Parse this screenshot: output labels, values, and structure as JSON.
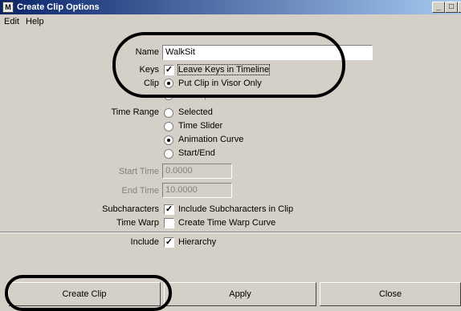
{
  "window": {
    "app_icon": "M",
    "title": "Create Clip Options",
    "min_glyph": "_",
    "max_glyph": "□",
    "close_glyph": "✕"
  },
  "menu": [
    "Edit",
    "Help"
  ],
  "fields": {
    "name_label": "Name",
    "name_value": "WalkSit",
    "keys_label": "Keys",
    "keys_option": "Leave Keys in Timeline",
    "clip_label": "Clip",
    "clip_option": "Put Clip in Visor Only",
    "clip_option_hidden": "Put Clip in Trax Editor and Visor",
    "time_range_label": "Time Range",
    "time_range_options": [
      "Selected",
      "Time Slider",
      "Animation Curve",
      "Start/End"
    ],
    "time_range_selected": "Animation Curve",
    "start_time_label": "Start Time",
    "start_time_value": "0.0000",
    "end_time_label": "End Time",
    "end_time_value": "10.0000",
    "subchars_label": "Subcharacters",
    "subchars_option": "Include Subcharacters in Clip",
    "timewarp_label": "Time Warp",
    "timewarp_option": "Create Time Warp Curve",
    "include_label": "Include",
    "include_option": "Hierarchy"
  },
  "checkboxes": {
    "keys": true,
    "subchars": true,
    "timewarp": false,
    "include": true
  },
  "buttons": {
    "create": "Create Clip",
    "apply": "Apply",
    "close": "Close"
  },
  "colors": {
    "dialog_bg": "#d4d0c8",
    "titlebar_start": "#0a246a",
    "titlebar_end": "#a6caf0",
    "annotation": "#000000"
  }
}
